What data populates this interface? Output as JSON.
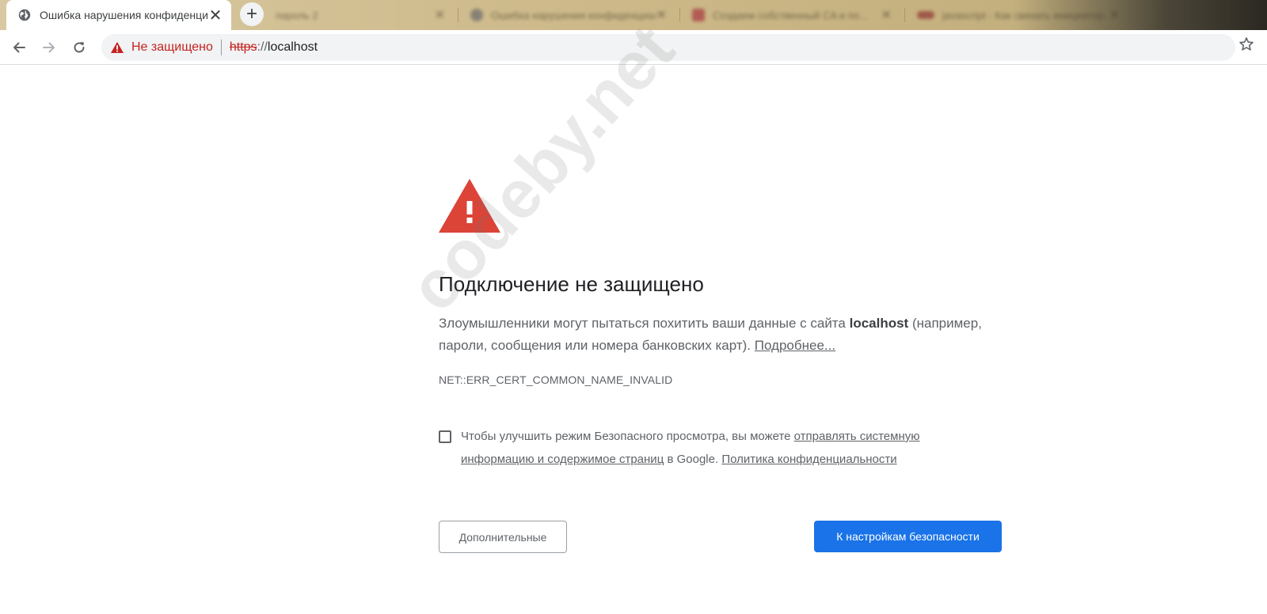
{
  "tabs": {
    "active": {
      "title": "Ошибка нарушения конфиденциальности",
      "icon": "globe-icon"
    },
    "background": [
      {
        "title": "пароль 2"
      },
      {
        "title": "Ошибка нарушения конфиденциальности"
      },
      {
        "title": "Создаем собственный CA и по..."
      },
      {
        "title": "javascript - Как связать инициатор..."
      }
    ]
  },
  "toolbar": {
    "security_state": "Не защищено",
    "url_scheme": "https",
    "url_separator": "://",
    "url_host": "localhost"
  },
  "interstitial": {
    "heading": "Подключение не защищено",
    "desc_before": "Злоумышленники могут пытаться похитить ваши данные с сайта ",
    "desc_host": "localhost",
    "desc_after": " (например, пароли, сообщения или номера банковских карт). ",
    "learn_more": "Подробнее...",
    "error_code": "NET::ERR_CERT_COMMON_NAME_INVALID",
    "optin_before": "Чтобы улучшить режим Безопасного просмотра, вы можете ",
    "optin_link": "отправлять системную информацию и содержимое страниц",
    "optin_middle": " в Google. ",
    "privacy_link": "Политика конфиденциальности",
    "advanced_button": "Дополнительные",
    "back_button": "К настройкам безопасности",
    "optin_checked": false
  },
  "watermark": "codeby.net",
  "colors": {
    "danger": "#db4437",
    "primary": "#1a73e8",
    "insecure_text": "#c5221f"
  }
}
